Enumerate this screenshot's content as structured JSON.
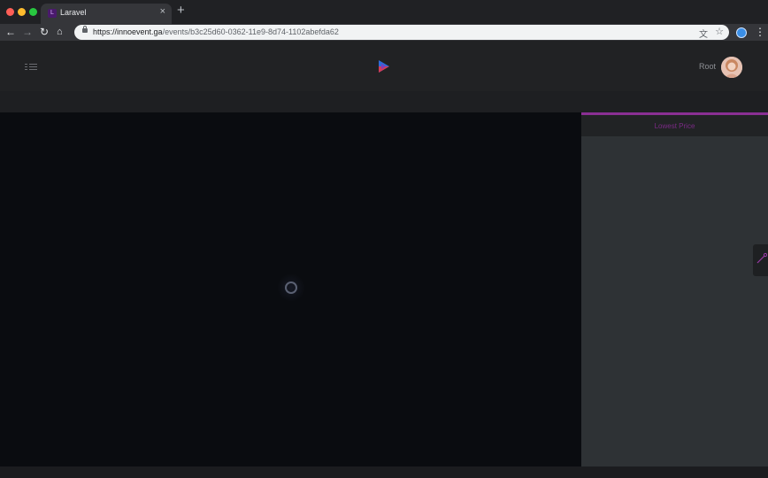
{
  "browser": {
    "tab": {
      "title": "Laravel",
      "favicon_letter": "L",
      "close_glyph": "×"
    },
    "new_tab_glyph": "+",
    "address_bar": {
      "url_host": "https://innoevent.ga",
      "url_path": "/events/b3c25d60-0362-11e9-8d74-1102abefda62"
    }
  },
  "header": {
    "user_name": "Root"
  },
  "side_panel": {
    "title": "Lowest Price"
  },
  "colors": {
    "accent": "#8a2f94",
    "page_background": "#0a0c10",
    "side_panel_background": "#2e3235"
  },
  "icons": {
    "nav": [
      "back-arrow-icon",
      "forward-arrow-icon",
      "reload-icon",
      "home-icon"
    ],
    "header": [
      "list-menu-icon",
      "app-logo-icon",
      "avatar"
    ],
    "side_tab": "settings-wand-icon"
  }
}
